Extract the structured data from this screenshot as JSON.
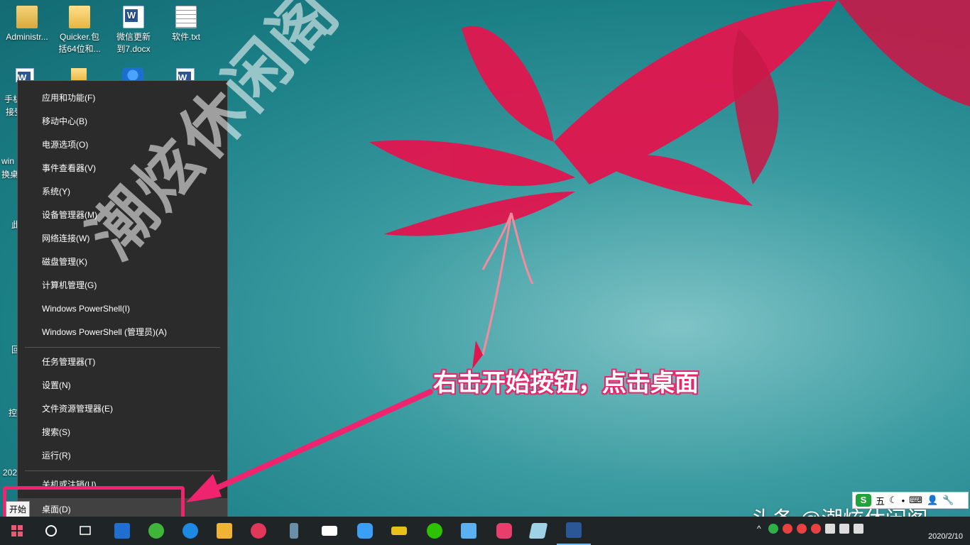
{
  "desktop_icons": [
    {
      "label": "Administr...",
      "icon": "user-folder-icon"
    },
    {
      "label": "Quicker.包括64位和...",
      "icon": "folder-icon"
    },
    {
      "label": "微信更新到7.docx",
      "icon": "word-doc-icon"
    },
    {
      "label": "软件.txt",
      "icon": "text-file-icon"
    }
  ],
  "partial_labels": [
    "手机",
    "接受",
    "win",
    "换桌",
    "此",
    "回",
    "控",
    "202"
  ],
  "watermark": "潮炫休闲阁",
  "menu": {
    "group1": [
      "应用和功能(F)",
      "移动中心(B)",
      "电源选项(O)",
      "事件查看器(V)",
      "系统(Y)",
      "设备管理器(M)",
      "网络连接(W)",
      "磁盘管理(K)",
      "计算机管理(G)",
      "Windows PowerShell(I)",
      "Windows PowerShell (管理员)(A)"
    ],
    "group2": [
      "任务管理器(T)",
      "设置(N)",
      "文件资源管理器(E)",
      "搜索(S)",
      "运行(R)"
    ],
    "group3": [
      "关机或注销(U)",
      "桌面(D)"
    ]
  },
  "annotation": "右击开始按钮，点击桌面",
  "start_tooltip": "开始",
  "source_mark": "头条 @潮炫休闲阁",
  "ime": {
    "label": "五"
  },
  "clock": {
    "date": "2020/2/10"
  },
  "colors": {
    "annotation_pink": "#f0246e",
    "menu_bg": "#2b2b2b",
    "taskbar_bg": "#1f2427"
  }
}
